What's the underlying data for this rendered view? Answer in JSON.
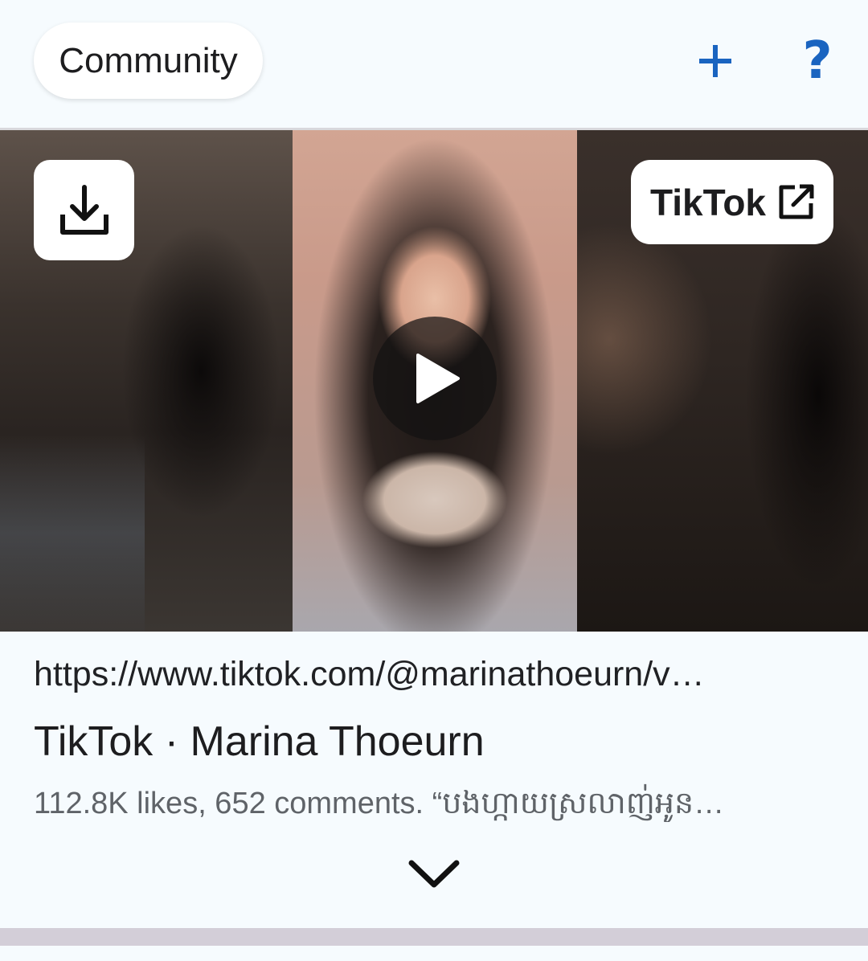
{
  "header": {
    "community_label": "Community",
    "add_icon": "plus-icon",
    "help_icon": "question-mark-icon"
  },
  "media": {
    "download_icon": "download-icon",
    "source_label": "TikTok",
    "external_icon": "open-external-icon",
    "play_icon": "play-icon"
  },
  "card": {
    "url": "https://www.tiktok.com/@marinathoeurn/v…",
    "title": "TikTok · Marina Thoeurn",
    "description": "112.8K likes, 652 comments. “បងហ្កាយស្រលាញ់អូន…",
    "expand_icon": "chevron-down-icon"
  },
  "colors": {
    "accent": "#1a64c0",
    "background": "#f6fbfe"
  }
}
